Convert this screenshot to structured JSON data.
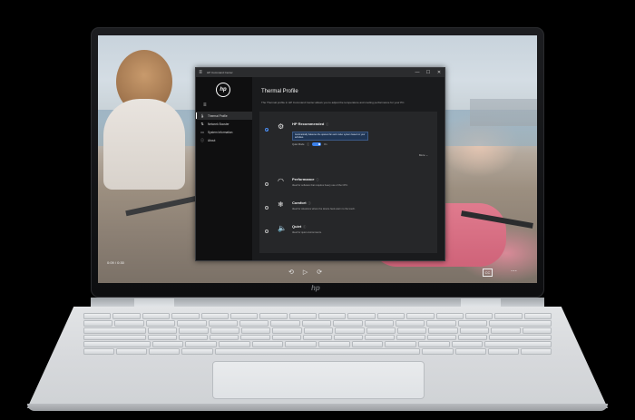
{
  "app": {
    "title": "HP Command Center",
    "hp_logo": "hp",
    "window_controls": [
      "—",
      "☐",
      "✕"
    ],
    "nav": [
      {
        "label": "Thermal Profile",
        "icon": "thermometer-icon",
        "active": true
      },
      {
        "label": "Network Booster",
        "icon": "network-icon",
        "active": false
      },
      {
        "label": "System Information",
        "icon": "info-icon",
        "active": false
      },
      {
        "label": "About",
        "icon": "about-icon",
        "active": false
      }
    ]
  },
  "page": {
    "title": "Thermal Profile",
    "description": "The Thermal profile in HP Command Center allows you to adjust the temperature and cooling performance for your PC."
  },
  "options": [
    {
      "id": "recommended",
      "title": "HP Recommended",
      "subtitle": "",
      "icon": "recommended-icon",
      "selected": true,
      "tooltip": "Automatically balances the quietest fan and cooler system based on your activities.",
      "quiet_label": "Quiet Mode",
      "toggle_label": "On",
      "more_label": "More ⌄"
    },
    {
      "id": "performance",
      "title": "Performance",
      "subtitle": "Ideal for software that requires heavy use of the CPU.",
      "icon": "gauge-icon",
      "selected": false
    },
    {
      "id": "comfort",
      "title": "Comfort",
      "subtitle": "Ideal for situations where the device feels warm to the touch.",
      "icon": "snowflake-icon",
      "selected": false
    },
    {
      "id": "quiet",
      "title": "Quiet",
      "subtitle": "Ideal for quiet environments.",
      "icon": "speaker-icon",
      "selected": false
    }
  ],
  "video": {
    "time": "0:09 / 0:30",
    "cc": "CC"
  },
  "laptop": {
    "lid_logo": "hp"
  }
}
